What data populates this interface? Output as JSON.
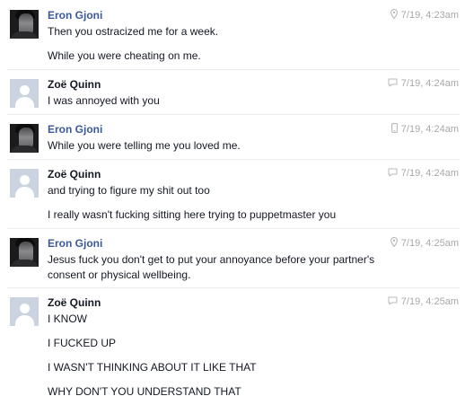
{
  "messages": [
    {
      "sender": "Eron Gjoni",
      "timestamp": "7/19, 4:23am",
      "via_icon": "location-pin-icon",
      "lines": [
        "Then you ostracized me for a week.",
        "While you were cheating on me."
      ]
    },
    {
      "sender": "Zoë Quinn",
      "timestamp": "7/19, 4:24am",
      "via_icon": "chat-bubble-icon",
      "lines": [
        "I was annoyed with you"
      ]
    },
    {
      "sender": "Eron Gjoni",
      "timestamp": "7/19, 4:24am",
      "via_icon": "mobile-phone-icon",
      "lines": [
        "While you were telling me you loved me."
      ]
    },
    {
      "sender": "Zoë Quinn",
      "timestamp": "7/19, 4:24am",
      "via_icon": "chat-bubble-icon",
      "lines": [
        "and trying to figure my shit out too",
        "I really wasn't fucking sitting here trying to puppetmaster you"
      ]
    },
    {
      "sender": "Eron Gjoni",
      "timestamp": "7/19, 4:25am",
      "via_icon": "location-pin-icon",
      "lines": [
        "Jesus fuck you don't get to put your annoyance before your partner's",
        "consent or physical wellbeing."
      ]
    },
    {
      "sender": "Zoë Quinn",
      "timestamp": "7/19, 4:25am",
      "via_icon": "chat-bubble-icon",
      "lines": [
        "I KNOW",
        "I FUCKED UP",
        "I WASN'T THINKING ABOUT IT LIKE THAT",
        "WHY DON'T YOU UNDERSTAND THAT"
      ]
    }
  ],
  "colors": {
    "sender_link": "#3b5998",
    "text": "#141823",
    "timestamp": "#a8a8a8",
    "separator": "#e9ebee"
  }
}
